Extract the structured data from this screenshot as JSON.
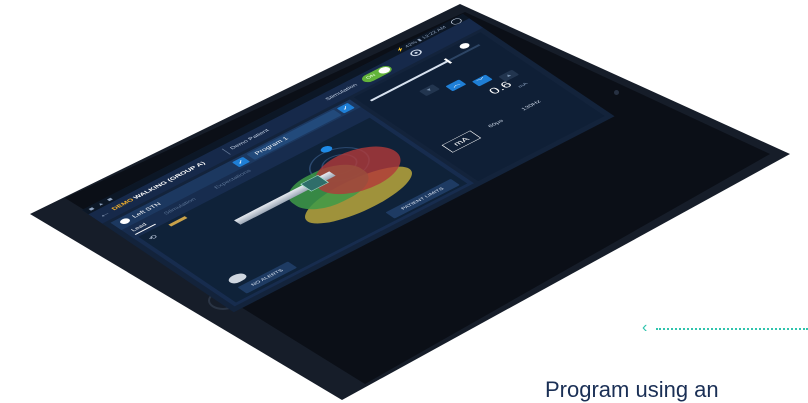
{
  "statusbar": {
    "left_icons": "◼ ▲ ◼",
    "right_text": "⚡ 42% ▮ 12:22 AM"
  },
  "appbar": {
    "demo_tag": "DEMO",
    "program_title": "WALKING (GROUP A)",
    "patient": "Demo Patient",
    "stimulation_label": "Stimulation",
    "toggle_state": "ON"
  },
  "left_panel": {
    "hemisphere": "Left STN",
    "program_select": "Program 1",
    "tabs": [
      "Lead",
      "Stimulation",
      "Expectations"
    ],
    "active_tab": "Lead",
    "buttons": {
      "patient_limits": "PATIENT LIMITS",
      "no_alerts": "NO ALERTS"
    },
    "lead_label": "L1"
  },
  "right_panel": {
    "amplitude_value": "0.6",
    "amplitude_unit": "mA",
    "units": [
      "mA",
      "60μs",
      "130Hz"
    ],
    "active_unit": "mA"
  },
  "caption": "Program using an"
}
